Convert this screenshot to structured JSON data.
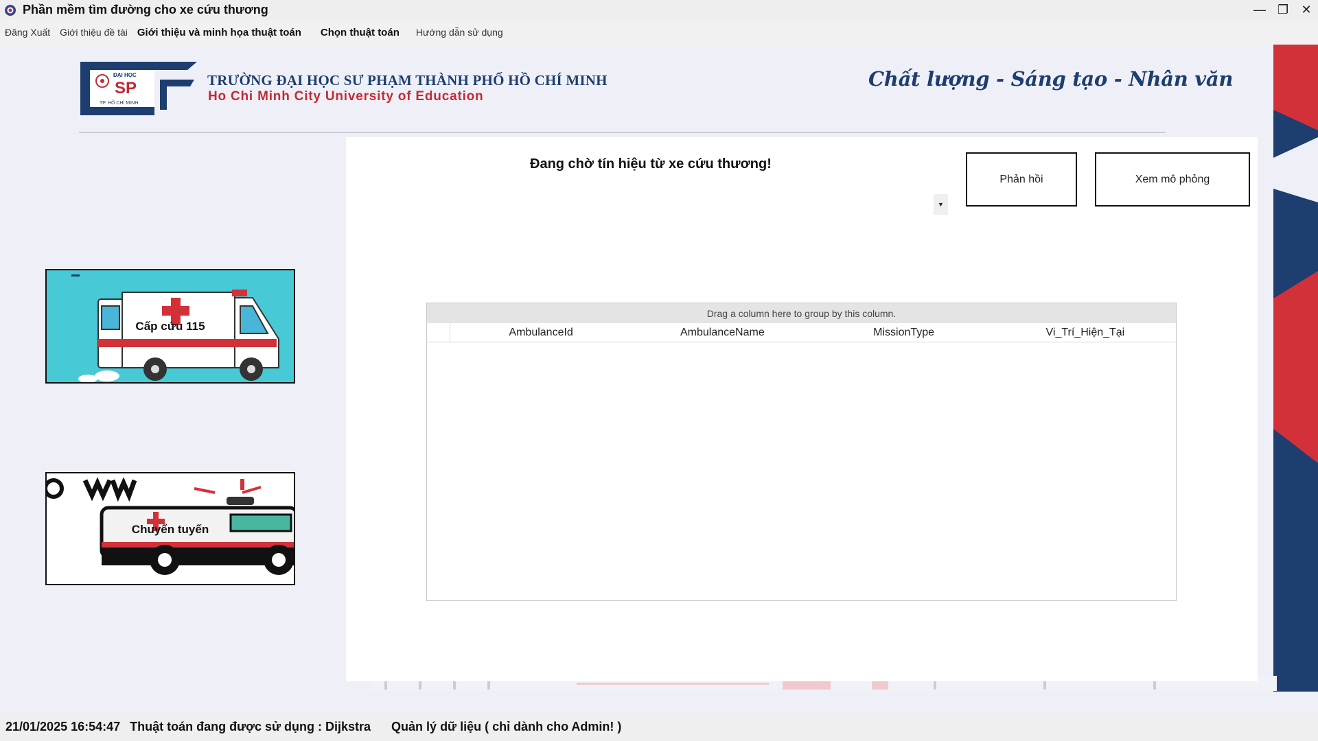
{
  "window": {
    "title": "Phần mềm tìm đường cho xe cứu thương",
    "controls": [
      "minimize",
      "restore",
      "close"
    ]
  },
  "menu": {
    "items": [
      {
        "label": "Đăng Xuất",
        "bold": false
      },
      {
        "label": "Giới thiệu đề tài",
        "bold": false
      },
      {
        "label": "Giới thiệu và minh họa thuật toán",
        "bold": true
      },
      {
        "label": "Chọn thuật toán",
        "bold": true
      },
      {
        "label": "Hướng dẫn sử dụng",
        "bold": false
      }
    ]
  },
  "header": {
    "logo_text": {
      "top": "ĐẠI HỌC",
      "main": "SP",
      "bottom": "TP. HỒ CHÍ MINH"
    },
    "university_vn": "TRƯỜNG ĐẠI HỌC SƯ PHẠM THÀNH PHỐ HỒ CHÍ MINH",
    "university_en": "Ho Chi Minh City University of Education",
    "slogan": "Chất lượng - Sáng tạo - Nhân văn"
  },
  "cards": {
    "cap_cuu": {
      "label": "Cấp cứu 115"
    },
    "chuyen_tuyen": {
      "label": "Chuyển tuyến"
    }
  },
  "main": {
    "status_message": "Đang chờ tín hiệu từ xe cứu thương!",
    "buttons": {
      "feedback": "Phản hồi",
      "simulation": "Xem mô phỏng"
    },
    "grid": {
      "group_panel_text": "Drag a column here to group by this column.",
      "columns": [
        "AmbulanceId",
        "AmbulanceName",
        "MissionType",
        "Vi_Trí_Hiện_Tại"
      ],
      "rows": []
    }
  },
  "statusbar": {
    "datetime": "21/01/2025 16:54:47",
    "algorithm": "Thuật toán đang được sử dụng : Dijkstra",
    "admin": "Quản lý dữ liệu ( chỉ dành cho Admin! )"
  },
  "colors": {
    "navy": "#1d3e6e",
    "red": "#c32a35",
    "teal": "#48c9d6"
  }
}
